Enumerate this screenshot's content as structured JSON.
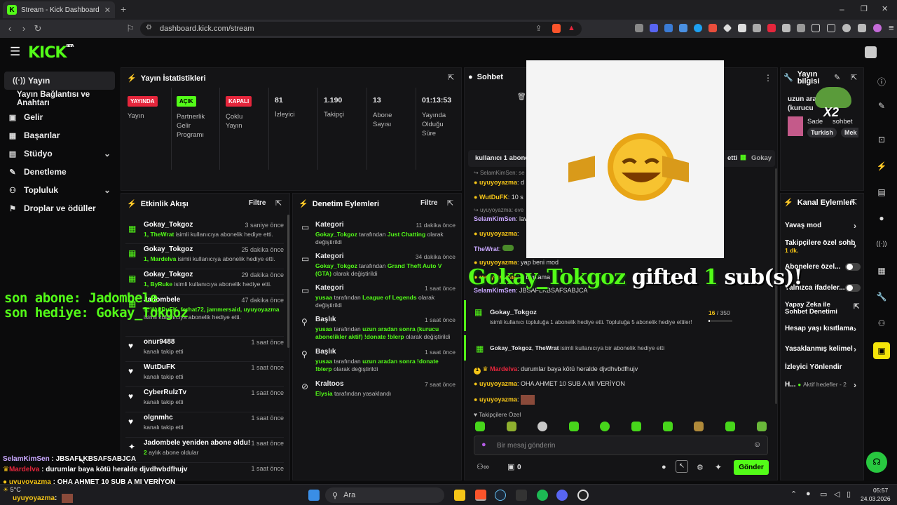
{
  "browser": {
    "tab_title": "Stream - Kick Dashboard",
    "new_tab": "+",
    "url": "dashboard.kick.com/stream",
    "window_controls": [
      "–",
      "❐",
      "✕"
    ]
  },
  "app": {
    "logo": "KICK",
    "logo_beta": "BETA"
  },
  "sidebar": {
    "items": [
      {
        "label": "Yayın",
        "icon": "broadcast-icon"
      },
      {
        "label": "Yayın Bağlantısı ve Anahtarı"
      },
      {
        "label": "Gelir",
        "icon": "revenue-icon"
      },
      {
        "label": "Başarılar",
        "icon": "achievements-icon"
      },
      {
        "label": "Stüdyo",
        "icon": "studio-icon"
      },
      {
        "label": "Denetleme",
        "icon": "moderation-icon"
      },
      {
        "label": "Topluluk",
        "icon": "community-icon"
      },
      {
        "label": "Droplar ve ödüller",
        "icon": "drops-icon"
      }
    ]
  },
  "stats": {
    "title": "Yayın İstatistikleri",
    "items": [
      {
        "badge": "YAYINDA",
        "label": "Yayın",
        "color": "#e5263c"
      },
      {
        "badge": "AÇIK",
        "label": "Partnerlik Gelir Programı",
        "color": "#53fc18"
      },
      {
        "badge": "KAPALI",
        "label": "Çoklu Yayın",
        "color": "#e5263c"
      },
      {
        "value": "81",
        "label": "İzleyici"
      },
      {
        "value": "1.190",
        "label": "Takipçi"
      },
      {
        "value": "13",
        "label": "Abone Sayısı"
      },
      {
        "value": "01:13:53",
        "label": "Yayında Olduğu Süre"
      }
    ]
  },
  "activity": {
    "title": "Etkinlik Akışı",
    "filter": "Filtre",
    "items": [
      {
        "name": "Gokay_Tokgoz",
        "time": "3 saniye önce",
        "desc_hl": "1, TheWrat",
        "desc": " isimli kullanıcıya abonelik hediye etti."
      },
      {
        "name": "Gokay_Tokgoz",
        "time": "25 dakika önce",
        "desc_hl": "1, Mardelva",
        "desc": " isimli kullanıcıya abonelik hediye etti."
      },
      {
        "name": "Gokay_Tokgoz",
        "time": "29 dakika önce",
        "desc_hl": "1, ByRuke",
        "desc": " isimli kullanıcıya abonelik hediye etti."
      },
      {
        "name": "Jadombele",
        "time": "47 dakika önce",
        "desc_hl": "5, WutDuFK, ferhat72, jammersaid, uyuyoyazma",
        "desc": " isimli kullanıcıya abonelik hediye etti."
      },
      {
        "name": "onur9488",
        "time": "1 saat önce",
        "desc": "kanalı takip etti"
      },
      {
        "name": "WutDuFK",
        "time": "1 saat önce",
        "desc": "kanalı takip etti"
      },
      {
        "name": "CyberRulzTv",
        "time": "1 saat önce",
        "desc": "kanalı takip etti"
      },
      {
        "name": "olgnmhc",
        "time": "1 saat önce",
        "desc": "kanalı takip etti"
      },
      {
        "name": "Jadombele yeniden abone oldu!",
        "time": "1 saat önce",
        "desc_hl": "2",
        "desc": " aylık abone oldular"
      },
      {
        "name": "",
        "time": "1 saat önce",
        "desc": ""
      }
    ]
  },
  "moderation": {
    "title": "Denetim Eylemleri",
    "filter": "Filtre",
    "items": [
      {
        "title": "Kategori",
        "time": "11 dakika önce",
        "user": "Gokay_Tokgoz",
        "mid": " tarafından ",
        "target": "Just Chatting",
        "end": " olarak değiştirildi"
      },
      {
        "title": "Kategori",
        "time": "34 dakika önce",
        "user": "Gokay_Tokgoz",
        "mid": " tarafından ",
        "target": "Grand Theft Auto V (GTA)",
        "end": " olarak değiştirildi"
      },
      {
        "title": "Kategori",
        "time": "1 saat önce",
        "user": "yusaa",
        "mid": " tarafından ",
        "target": "League of Legends",
        "end": " olarak değiştirildi"
      },
      {
        "title": "Başlık",
        "time": "1 saat önce",
        "user": "yusaa",
        "mid": " tarafından ",
        "target": "uzun aradan sonra (kurucu abonelikler aktif) !donate !blerp",
        "end": " olarak değiştirildi"
      },
      {
        "title": "Başlık",
        "time": "1 saat önce",
        "user": "yusaa",
        "mid": " tarafından ",
        "target": "uzun aradan sonra !donate !blerp",
        "end": " olarak değiştirildi"
      },
      {
        "title": "Kraltoos",
        "time": "7 saat önce",
        "user": "Elysia",
        "mid": " tarafından yasaklandı",
        "target": "",
        "end": ""
      }
    ]
  },
  "chat": {
    "title": "Sohbet",
    "pinned": "kullanıcı 1 abone",
    "pinned_right": "etti",
    "pinned_user": "Gokay",
    "lines": [
      {
        "reply": "SelamKimSen: se",
        "user": "",
        "text": ""
      },
      {
        "user": "uyuyoyazma",
        "text": ": d",
        "color": "#f5c518"
      },
      {
        "user": "WutDuFK",
        "text": ": 10 s",
        "color": "#f5c518"
      },
      {
        "reply": "uyuyoyazma: eve",
        "user": "",
        "text": ""
      },
      {
        "user": "SelamKimSen",
        "text": ": lav",
        "color": "#c9a8ff"
      },
      {
        "user": "uyuyoyazma",
        "text": ":",
        "color": "#f5c518"
      },
      {
        "user": "TheWrat",
        "text": ":",
        "color": "#c9a8ff"
      },
      {
        "user": "uyuyoyazma",
        "text": ": yap beni mod",
        "color": "#f5c518"
      },
      {
        "user": "uyuyoyazma",
        "text": ": u banlama",
        "color": "#f5c518"
      },
      {
        "user": "uyuyoyazma",
        "text": ":",
        "color": "#f5c518"
      },
      {
        "user": "SelamKimSen",
        "text": ": JBSAFLKBSAFSABJCA",
        "color": "#c9a8ff"
      }
    ],
    "gift_event": {
      "user": "Gokay_Tokgoz",
      "progress": "16",
      "goal": "/ 350",
      "progress_fraction": 0.046,
      "desc": "isimli kullanıcı topluluğa 1 abonelik hediye etti. Topluluğa 5 abonelik hediye ettiler!"
    },
    "gift_event2": {
      "user": "Gokay_Tokgoz",
      "target": "TheWrat",
      "desc": " isimli kullanıcıya bir abonelik hediye etti"
    },
    "after": [
      {
        "user": "Mardelva",
        "text": ": durumlar baya kötü heralde djvdhvbdfhujv",
        "color": "#e5263c",
        "badge": "1"
      },
      {
        "user": "uyuyoyazma",
        "text": ": OHA AHMET 10 SUB A MI VERİYON",
        "color": "#f5c518"
      },
      {
        "user": "uyuyoyazma",
        "text": ":",
        "color": "#f5c518"
      }
    ],
    "followers_only": "Takipçilere Özel",
    "input_placeholder": "Bir mesaj gönderin",
    "count": "0",
    "send": "Gönder"
  },
  "streaminfo": {
    "title": "Yayın bilgisi",
    "stream_title": "uzun arad",
    "stream_title2": "(kurucu",
    "category": "Sade",
    "category2": "sohbet",
    "tags": [
      "Turkish",
      "Mek"
    ]
  },
  "channel_actions": {
    "title": "Kanal Eylemleri",
    "items": [
      {
        "label": "Yavaş mod",
        "type": "arrow"
      },
      {
        "label": "Takipçilere özel sohb",
        "sub": "1 dk.",
        "type": "arrow"
      },
      {
        "label": "Abonelere özel...",
        "type": "toggle"
      },
      {
        "label": "Yalnızca ifadeler...",
        "type": "toggle"
      },
      {
        "label": "Yapay Zeka ile Sohbet Denetimi",
        "type": "ext"
      },
      {
        "label": "Hesap yaşı kısıtlama",
        "type": "arrow"
      },
      {
        "label": "Yasaklanmış kelimel",
        "type": "arrow"
      },
      {
        "label": "İzleyici Yönlendir",
        "type": "none"
      },
      {
        "label": "H...",
        "sub": "Aktif hedefler - 2",
        "type": "arrow"
      }
    ]
  },
  "overlays": {
    "last_sub": "son abone: Jadombele",
    "last_gift": "son hediye: Gokay_Tokgoz",
    "gift_user": "Gokay_Tokgoz",
    "gift_word": "gifted",
    "gift_count": "1",
    "gift_suffix": "sub(s)!",
    "x2": "X2"
  },
  "overlay_chat": [
    {
      "user": "SelamKimSen",
      "text": " : JBSAFLKBSAFSABJCA",
      "color": "#c9a8ff"
    },
    {
      "user": "Mardelva",
      "text": " : durumlar baya kötü heralde djvdhvbdfhujv",
      "color": "#e5263c"
    },
    {
      "user": "uyuyoyazma",
      "text": " : OHA AHMET 10 SUB A MI VERİYON",
      "color": "#f5c518"
    },
    {
      "user": "uyuyoyazma",
      "text": " :",
      "color": "#f5c518"
    }
  ],
  "taskbar": {
    "search": "Ara",
    "time": "05:57",
    "date": "24.03.2026",
    "weather": "5°C"
  }
}
